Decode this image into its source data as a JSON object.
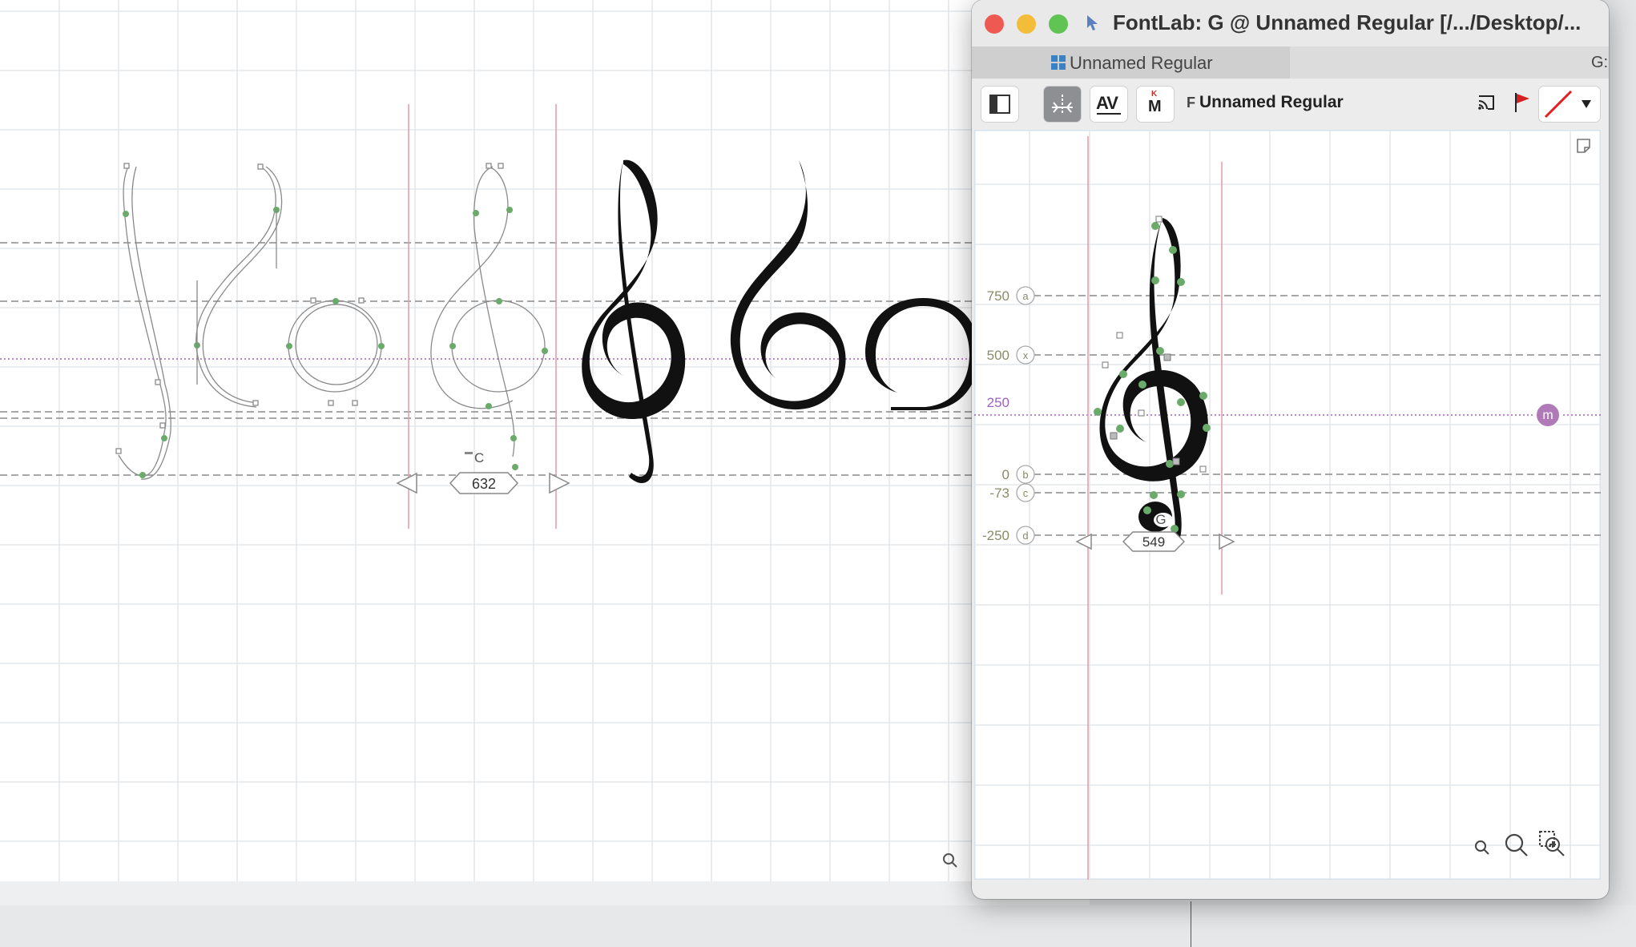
{
  "window": {
    "title": "FontLab: G @ Unnamed Regular [/.../Desktop/...",
    "tabs": [
      {
        "label": "Unnamed Regular",
        "active": true
      },
      {
        "label": "G:",
        "glyph": "𝄞",
        "active": false
      }
    ],
    "toolbar": {
      "font_prefix": "F",
      "font_name": "Unnamed Regular",
      "kern_label": "AV",
      "kern_sub": "K",
      "metrics_label": "M"
    }
  },
  "main_canvas": {
    "glyph_label": "C",
    "advance_width": "632"
  },
  "glyph_window": {
    "metric_values": [
      "750",
      "500",
      "250",
      "0",
      "-73",
      "-250"
    ],
    "metric_letters": [
      "a",
      "x",
      "b",
      "c",
      "d"
    ],
    "mark_label": "m",
    "glyph_label": "G",
    "advance_width": "549"
  },
  "colors": {
    "close": "#ee5a52",
    "minimize": "#f4bd39",
    "zoom": "#5fc453",
    "node_green": "#6aab6a",
    "sidebearing_red": "#e3a0a8",
    "measure_purple": "#a060c0",
    "metric_dash": "#8a8a8a",
    "accent_blue": "#3b82c4"
  },
  "icons": [
    "close-button",
    "minimize-button",
    "zoom-button",
    "pointer-icon",
    "font-icon",
    "sidebar-toggle-icon",
    "metrics-icon",
    "kerning-icon",
    "mark-icon",
    "cast-icon",
    "flag-icon",
    "color-swatch-icon",
    "dropdown-chevron-icon",
    "zoom-out-icon",
    "zoom-in-icon",
    "zoom-selection-icon",
    "resize-corner-icon"
  ]
}
